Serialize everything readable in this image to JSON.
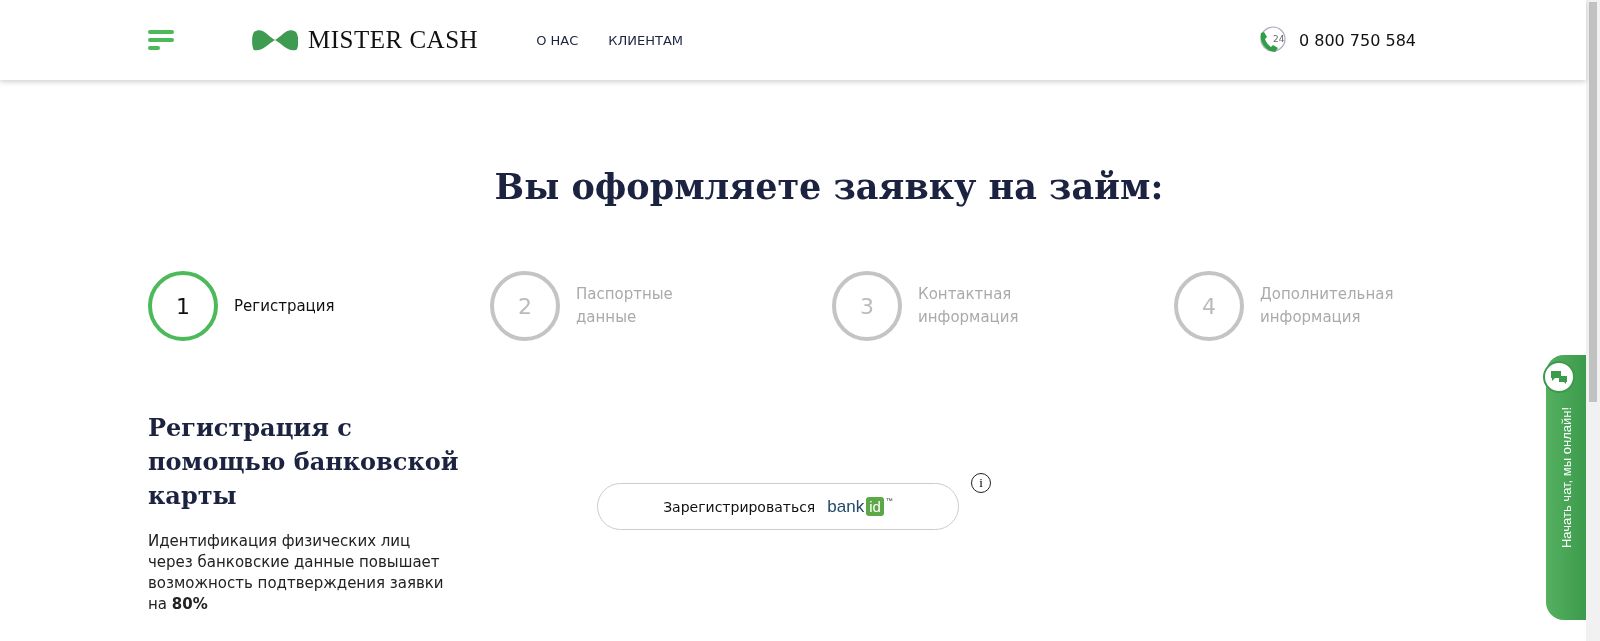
{
  "header": {
    "logo_text": "MISTER CASH",
    "nav": [
      {
        "label": "О НАС"
      },
      {
        "label": "КЛИЕНТАМ"
      }
    ],
    "phone": "0 800 750 584",
    "phone_badge": "24"
  },
  "title": "Вы оформляете заявку на займ:",
  "steps": [
    {
      "number": "1",
      "label": "Регистрация",
      "selected": true
    },
    {
      "number": "2",
      "label": "Паспортные данные",
      "selected": false
    },
    {
      "number": "3",
      "label": "Контактная информация",
      "selected": false
    },
    {
      "number": "4",
      "label": "Дополнительная информация",
      "selected": false
    }
  ],
  "registration": {
    "heading": "Регистрация с помощью банковской карты",
    "description": "Идентификация физических лиц через банковские данные повышает возможность подтверждения заявки на **80%**",
    "button": {
      "label": "Зарегистрироваться",
      "logo_word": "bank",
      "logo_badge": "id",
      "logo_mark": "™"
    },
    "info": "i"
  },
  "chat": {
    "label": "Начать чат, мы онлайн!"
  }
}
